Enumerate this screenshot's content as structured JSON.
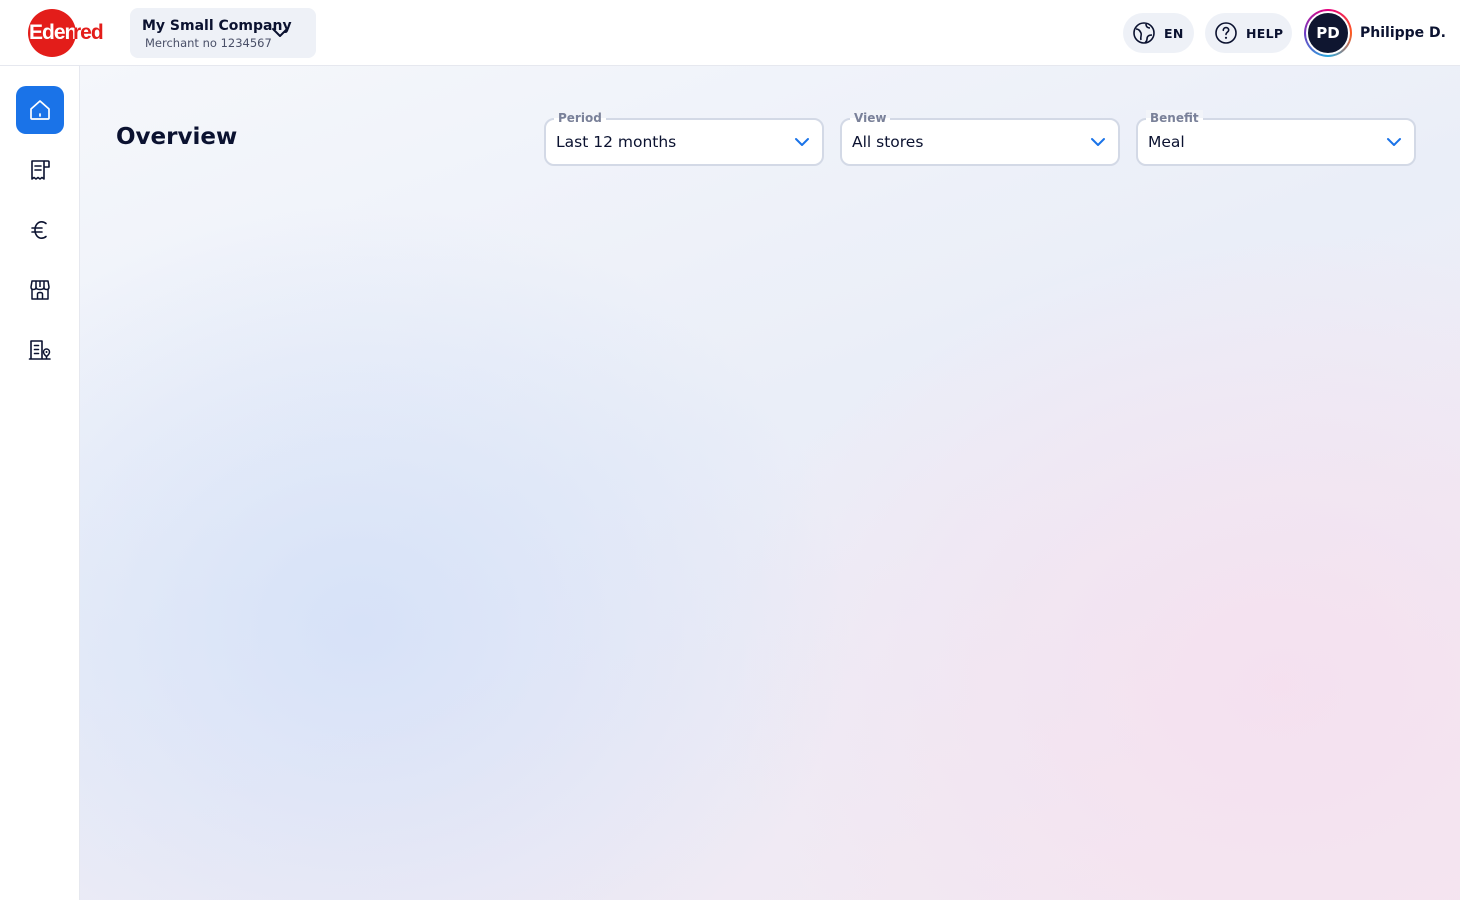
{
  "header": {
    "logo_text": "Edenred",
    "company": {
      "name": "My Small Company",
      "merchant": "Merchant no 1234567"
    },
    "language": {
      "label": "EN",
      "icon": "globe-icon"
    },
    "help": {
      "label": "HELP",
      "icon": "question-circle-icon"
    },
    "user": {
      "initials": "PD",
      "name": "Philippe D."
    }
  },
  "sidebar": {
    "items": [
      {
        "name": "home",
        "icon": "home-icon",
        "active": true
      },
      {
        "name": "transactions",
        "icon": "receipt-icon",
        "active": false
      },
      {
        "name": "payments",
        "icon": "euro-icon",
        "active": false
      },
      {
        "name": "stores",
        "icon": "store-icon",
        "active": false
      },
      {
        "name": "company",
        "icon": "building-location-icon",
        "active": false
      }
    ]
  },
  "main": {
    "title": "Overview",
    "filters": {
      "period": {
        "label": "Period",
        "value": "Last 12 months"
      },
      "view": {
        "label": "View",
        "value": "All stores"
      },
      "benefit": {
        "label": "Benefit",
        "value": "Meal"
      }
    }
  },
  "colors": {
    "brand_red": "#e31d1a",
    "accent_blue": "#1a73e8",
    "text_dark": "#0b1230"
  }
}
